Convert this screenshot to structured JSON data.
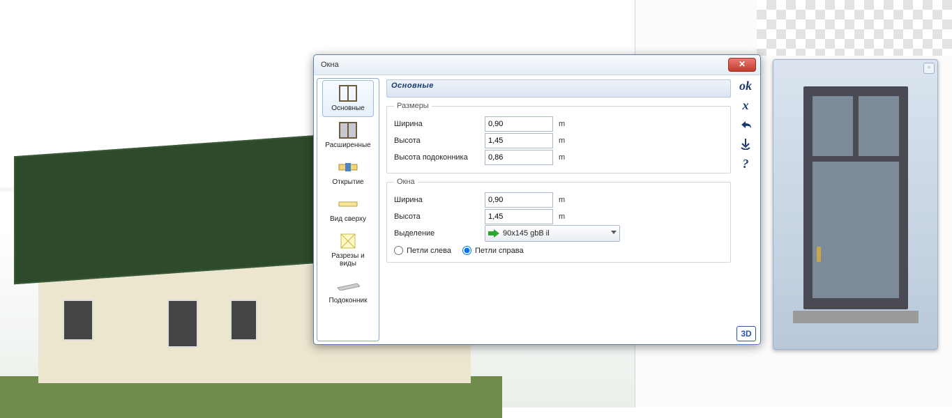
{
  "dialog": {
    "title": "Окна",
    "header": "Основные"
  },
  "sidebar": {
    "items": [
      {
        "label": "Основные"
      },
      {
        "label": "Расширенные"
      },
      {
        "label": "Открытие"
      },
      {
        "label": "Вид сверху"
      },
      {
        "label": "Разрезы и виды"
      },
      {
        "label": "Подоконник"
      }
    ]
  },
  "groups": {
    "sizes": {
      "legend": "Размеры",
      "width_label": "Ширина",
      "width_value": "0,90",
      "height_label": "Высота",
      "height_value": "1,45",
      "sill_label": "Высота подоконника",
      "sill_value": "0,86",
      "unit": "m"
    },
    "window": {
      "legend": "Окна",
      "width_label": "Ширина",
      "width_value": "0,90",
      "height_label": "Высота",
      "height_value": "1,45",
      "unit": "m",
      "selection_label": "Выделение",
      "selection_value": "90x145 gbB il",
      "hinge_left": "Петли слева",
      "hinge_right": "Петли справа"
    }
  },
  "actions": {
    "ok": "ok",
    "cancel": "x",
    "revert": "↩",
    "save": "⥥",
    "help": "?",
    "badge": "3D"
  }
}
